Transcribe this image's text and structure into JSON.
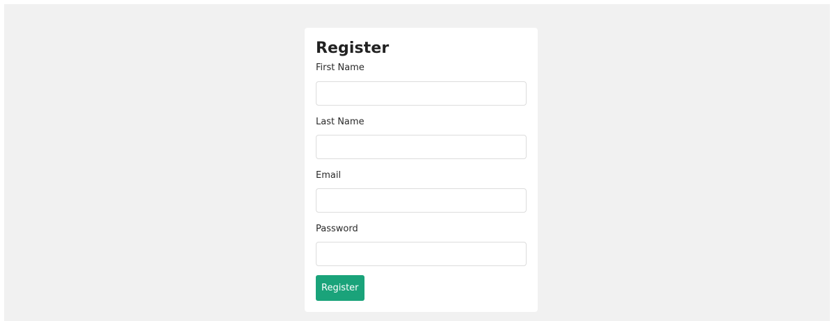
{
  "form": {
    "title": "Register",
    "fields": [
      {
        "label": "First Name",
        "value": "",
        "placeholder": ""
      },
      {
        "label": "Last Name",
        "value": "",
        "placeholder": ""
      },
      {
        "label": "Email",
        "value": "",
        "placeholder": ""
      },
      {
        "label": "Password",
        "value": "",
        "placeholder": ""
      }
    ],
    "submit_label": "Register"
  },
  "colors": {
    "page_background": "#f1f1f1",
    "card_background": "#ffffff",
    "accent": "#1aa37a"
  }
}
